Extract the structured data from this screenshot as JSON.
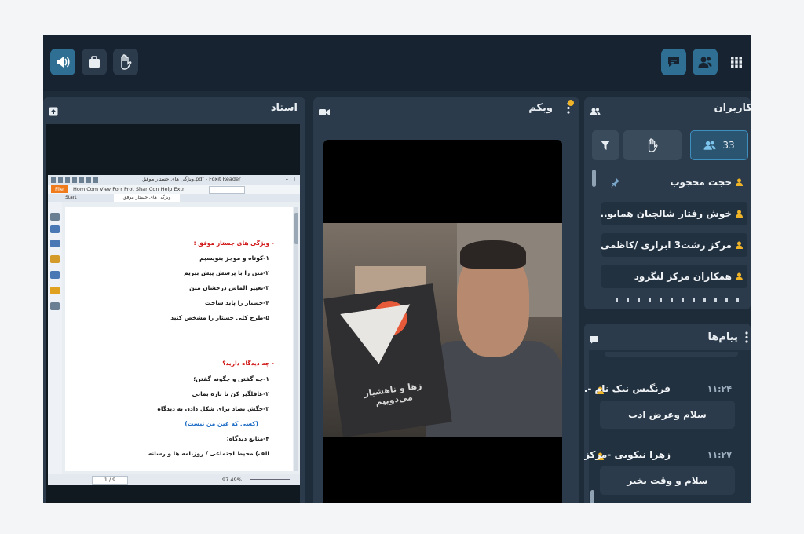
{
  "toolbar": {
    "left_icons": [
      "speaker-icon",
      "briefcase-icon",
      "raise-hand-icon"
    ],
    "right_icons": [
      "chat-icon",
      "users-icon",
      "grid-menu-icon"
    ]
  },
  "teacher_panel": {
    "title": "استاد",
    "viewer": {
      "window_title": "ویژگی های جستار موفق.pdf - Foxit Reader",
      "menu_file": "File",
      "menu_items": "Hom Com Viev Forr Prot Shar Con Help Extr",
      "tab_start": "Start",
      "tab_doc": "ویژگی های جستار موفق",
      "page_indicator": "1 / 9",
      "zoom": "97.49%"
    },
    "doc": {
      "heading1": "- ویژگی های جستار موفق :",
      "list1": [
        "۱-کوتاه و موجز بنویسیم",
        "۲-متن را با پرسش پیش ببریم",
        "۳-تغییر الماس درخشان متن",
        "۴-جستار را پاید ساخت",
        "۵-طرح کلی جستار را مشخص کنید"
      ],
      "heading2": "- چه دیدگاه دارید؟",
      "list2": [
        "۱-چه گفتن و چگونه گفتن؛",
        "۲-غافلگیر کن تا تازه بمانی",
        "۳-چگش تضاد برای شکل دادن به دیدگاه"
      ],
      "note": "(کسی که عین من نیست)",
      "list3": [
        "۴-منابع دیدگاه:",
        "الف) محیط اجتماعی / روزنامه ها و رسانه"
      ]
    }
  },
  "webcam_panel": {
    "title": "وبکم",
    "book_title": "زها و ناهشیار می‌دوییم"
  },
  "users_panel": {
    "title": "کاربران",
    "count": "33",
    "users": [
      "حجت محجوب",
      "خوش رفتار شالچیان همایو...",
      "مرکز رشت3 ابراری /کاظمی",
      "همکاران مرکز لنگرود"
    ]
  },
  "messages_panel": {
    "title": "پیام‌ها",
    "messages": [
      {
        "name": "فرنگیس نیک نام -...",
        "time": "۱۱:۲۴",
        "text": "سلام وعرض ادب"
      },
      {
        "name": "زهرا نیکویی -مرکز...",
        "time": "۱۱:۲۷",
        "text": "سلام و وقت بخیر"
      }
    ]
  },
  "colors": {
    "app_bg": "#1e2b39",
    "topbar_bg": "#172330",
    "active_button": "#2f6f93",
    "user_icon": "#f0b429",
    "icon_light": "#e8edf2",
    "heading_red": "#d01414",
    "note_blue": "#1b6bc4"
  }
}
